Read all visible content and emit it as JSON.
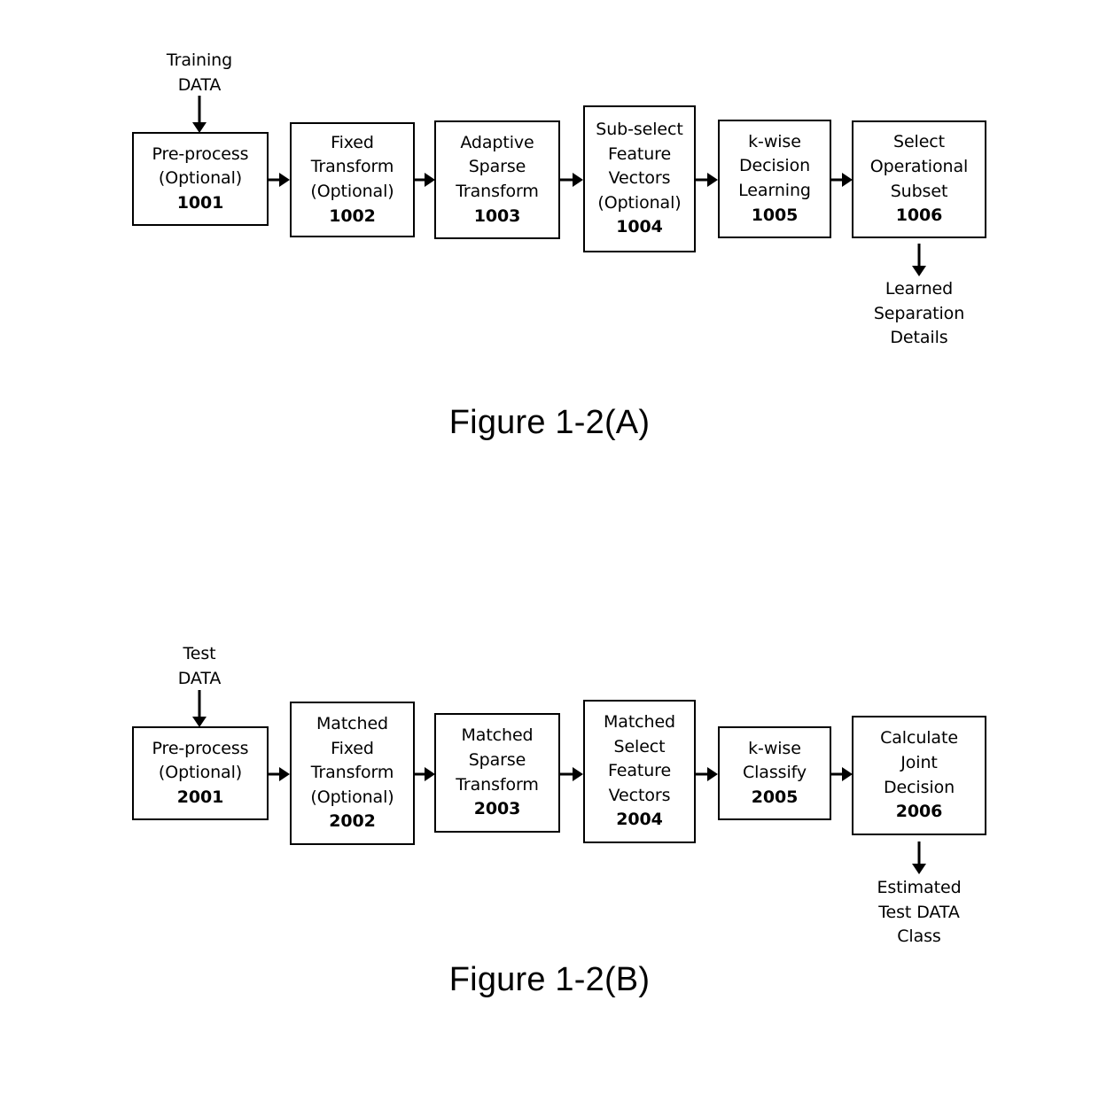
{
  "figures": [
    {
      "id": "figure-1-2-a",
      "caption": "Figure 1-2(A)",
      "input_label": {
        "lines": [
          "Training",
          "DATA"
        ]
      },
      "output_label": {
        "lines": [
          "Learned",
          "Separation",
          "Details"
        ]
      },
      "boxes": [
        {
          "lines": [
            "Pre-process",
            "(Optional)"
          ],
          "ref": "1001"
        },
        {
          "lines": [
            "Fixed",
            "Transform",
            "(Optional)"
          ],
          "ref": "1002"
        },
        {
          "lines": [
            "Adaptive",
            "Sparse",
            "Transform"
          ],
          "ref": "1003"
        },
        {
          "lines": [
            "Sub-select",
            "Feature",
            "Vectors",
            "(Optional)"
          ],
          "ref": "1004"
        },
        {
          "lines": [
            "k-wise",
            "Decision",
            "Learning"
          ],
          "ref": "1005"
        },
        {
          "lines": [
            "Select",
            "Operational",
            "Subset"
          ],
          "ref": "1006"
        }
      ]
    },
    {
      "id": "figure-1-2-b",
      "caption": "Figure 1-2(B)",
      "input_label": {
        "lines": [
          "Test",
          "DATA"
        ]
      },
      "output_label": {
        "lines": [
          "Estimated",
          "Test DATA",
          "Class"
        ]
      },
      "boxes": [
        {
          "lines": [
            "Pre-process",
            "(Optional)"
          ],
          "ref": "2001"
        },
        {
          "lines": [
            "Matched",
            "Fixed",
            "Transform",
            "(Optional)"
          ],
          "ref": "2002"
        },
        {
          "lines": [
            "Matched",
            "Sparse",
            "Transform"
          ],
          "ref": "2003"
        },
        {
          "lines": [
            "Matched",
            "Select",
            "Feature",
            "Vectors"
          ],
          "ref": "2004"
        },
        {
          "lines": [
            "k-wise",
            "Classify"
          ],
          "ref": "2005"
        },
        {
          "lines": [
            "Calculate",
            "Joint",
            "Decision"
          ],
          "ref": "2006"
        }
      ]
    }
  ],
  "colors": {
    "stroke": "#000000",
    "background": "#ffffff",
    "text": "#000000"
  }
}
